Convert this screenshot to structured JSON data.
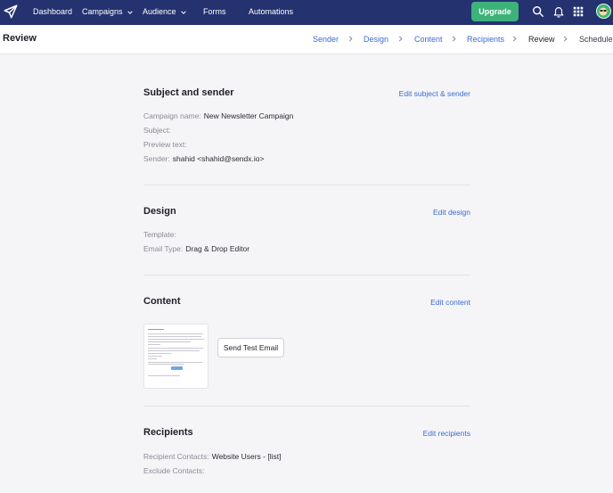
{
  "nav": {
    "items": [
      {
        "label": "Dashboard"
      },
      {
        "label": "Campaigns"
      },
      {
        "label": "Audience"
      },
      {
        "label": "Forms"
      },
      {
        "label": "Automations"
      }
    ],
    "upgrade_label": "Upgrade",
    "icons": [
      "search-icon",
      "bell-icon",
      "apps-grid-icon"
    ],
    "colors": {
      "bar": "#243270",
      "upgrade": "#3db27a"
    }
  },
  "header": {
    "title": "Review",
    "steps": [
      {
        "label": "Sender",
        "state": "done"
      },
      {
        "label": "Design",
        "state": "done"
      },
      {
        "label": "Content",
        "state": "done"
      },
      {
        "label": "Recipients",
        "state": "done"
      },
      {
        "label": "Review",
        "state": "active"
      },
      {
        "label": "Schedule",
        "state": "pending"
      }
    ]
  },
  "subject_sender": {
    "title": "Subject and sender",
    "edit_label": "Edit subject & sender",
    "campaign_name_label": "Campaign name:",
    "campaign_name_value": "New Newsletter Campaign",
    "subject_label": "Subject:",
    "subject_value": "",
    "preview_text_label": "Preview text:",
    "preview_text_value": "",
    "sender_label": "Sender:",
    "sender_value": "shahid <shahid@sendx.io>"
  },
  "design": {
    "title": "Design",
    "edit_label": "Edit design",
    "template_label": "Template:",
    "template_value": "",
    "email_type_label": "Email Type:",
    "email_type_value": "Drag & Drop Editor"
  },
  "content": {
    "title": "Content",
    "edit_label": "Edit content",
    "send_test_label": "Send Test Email"
  },
  "recipients": {
    "title": "Recipients",
    "edit_label": "Edit recipients",
    "recipient_contacts_label": "Recipient Contacts:",
    "recipient_contacts_value": "Website Users - [list]",
    "exclude_contacts_label": "Exclude Contacts:",
    "exclude_contacts_value": ""
  }
}
